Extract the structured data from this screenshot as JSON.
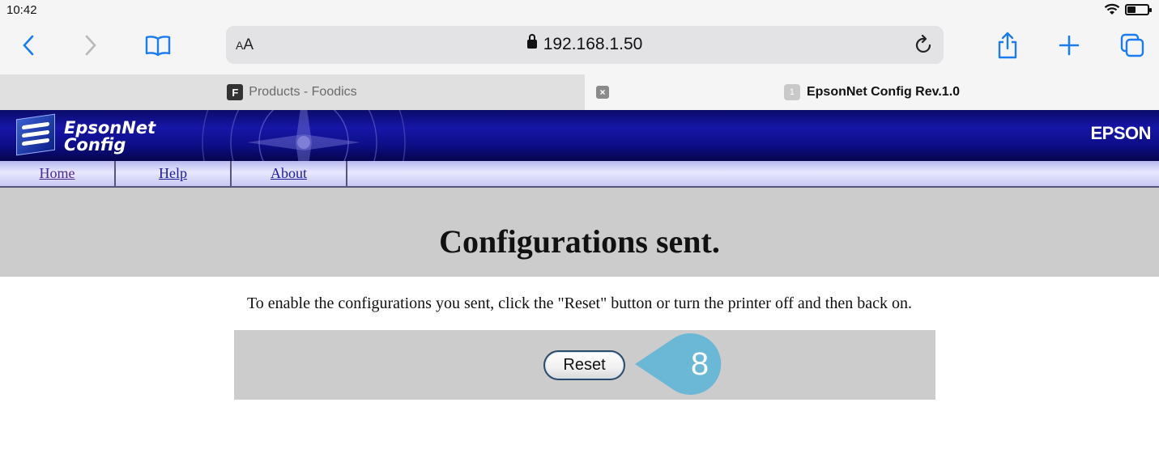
{
  "status": {
    "time": "10:42"
  },
  "address_bar": {
    "text_size_label": "AA",
    "url": "192.168.1.50"
  },
  "tabs": [
    {
      "favicon": "F",
      "label": "Products - Foodics",
      "active": false
    },
    {
      "favicon": "1",
      "label": "EpsonNet Config Rev.1.0",
      "active": true
    }
  ],
  "banner": {
    "logo_line1": "EpsonNet",
    "logo_line2": "Config",
    "brand": "EPSON"
  },
  "nav": {
    "home": "Home",
    "help": "Help",
    "about": "About"
  },
  "page": {
    "title": "Configurations sent.",
    "message": "To enable the configurations you sent, click the \"Reset\" button or turn the printer off and then back on.",
    "reset_label": "Reset"
  },
  "callout": {
    "number": "8",
    "color": "#6bb8d6"
  },
  "colors": {
    "accent": "#1a7cf0",
    "banner": "#1616a8",
    "band": "#cccccc"
  }
}
